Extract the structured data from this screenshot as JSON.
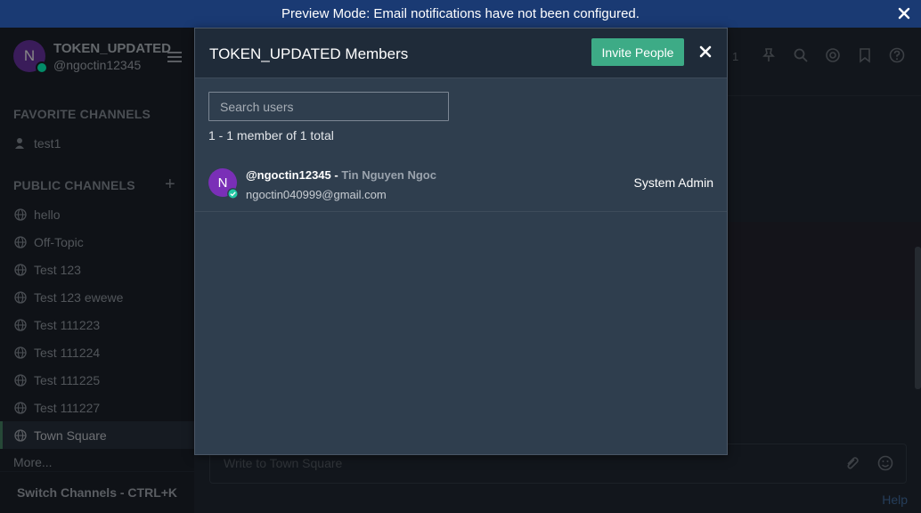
{
  "banner": {
    "text": "Preview Mode: Email notifications have not been configured."
  },
  "sidebar": {
    "team_name": "TOKEN_UPDATED",
    "user_handle": "@ngoctin12345",
    "avatar_initial": "N",
    "favorite_title": "FAVORITE CHANNELS",
    "favorite_channels": [
      "test1"
    ],
    "public_title": "PUBLIC CHANNELS",
    "public_channels": [
      "hello",
      "Off-Topic",
      "Test 123",
      "Test 123 ewewe",
      "Test 111223",
      "Test 111224",
      "Test 111225",
      "Test 111227",
      "Town Square"
    ],
    "active_channel": "Town Square",
    "more_label": "More...",
    "switch_label": "Switch Channels - CTRL+K"
  },
  "main": {
    "member_count_partial": "1",
    "input_placeholder": "Write to Town Square",
    "help_label": "Help"
  },
  "modal": {
    "title": "TOKEN_UPDATED Members",
    "invite_label": "Invite People",
    "search_placeholder": "Search users",
    "count_text": "1 - 1 member of 1 total",
    "members": [
      {
        "initial": "N",
        "username": "@ngoctin12345",
        "separator": " - ",
        "full_name": "Tin Nguyen Ngoc",
        "email": "ngoctin040999@gmail.com",
        "role": "System Admin"
      }
    ]
  },
  "colors": {
    "banner": "#1a3a73",
    "accent": "#3dab86",
    "status_online": "#06d6a0",
    "avatar": "#7a2fb7"
  },
  "icons": [
    "close-icon",
    "menu-icon",
    "globe-icon",
    "private-channel-icon",
    "plus-icon",
    "pin-icon",
    "search-icon",
    "mention-icon",
    "bookmark-icon",
    "help-icon",
    "attachment-icon",
    "emoji-icon",
    "check-icon"
  ]
}
